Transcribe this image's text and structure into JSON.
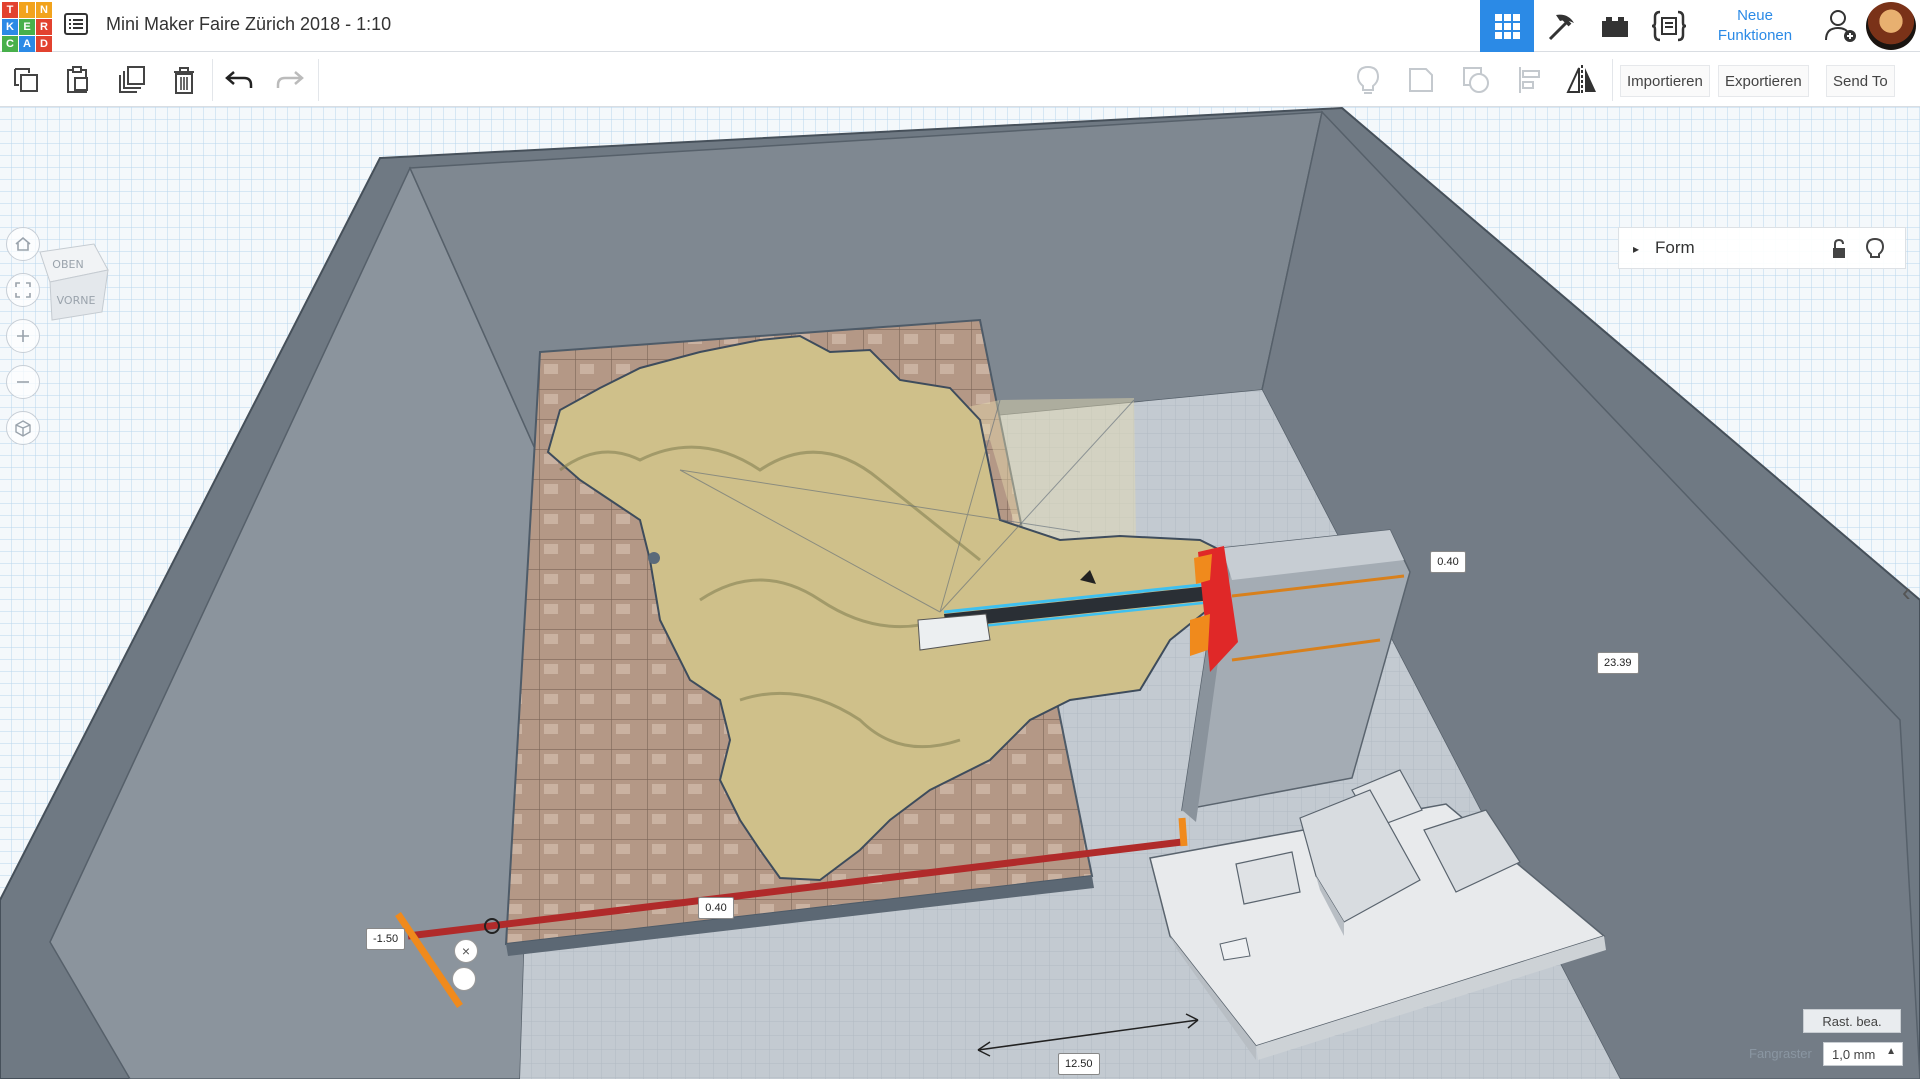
{
  "app": {
    "logo_letters": [
      "T",
      "I",
      "N",
      "K",
      "E",
      "R",
      "C",
      "A",
      "D"
    ],
    "logo_colors": [
      "#e2422f",
      "#f2a31c",
      "#f2a31c",
      "#2b8ae6",
      "#48b04b",
      "#e2422f",
      "#48b04b",
      "#2b8ae6",
      "#e2422f"
    ],
    "project_title": "Mini Maker Faire Zürich 2018 - 1:10",
    "accent_color": "#2b8ae6",
    "menu_icon": "list-menu-icon"
  },
  "topbar": {
    "views": [
      {
        "name": "3d-view",
        "icon": "grid-icon",
        "active": true
      },
      {
        "name": "blocks",
        "icon": "pickaxe-icon",
        "active": false
      },
      {
        "name": "bricks",
        "icon": "brick-icon",
        "active": false
      },
      {
        "name": "codeblocks",
        "icon": "code-icon",
        "active": false
      }
    ],
    "new_features_line1": "Neue",
    "new_features_line2": "Funktionen",
    "user_icon": "add-user-icon"
  },
  "toolbar": {
    "left_icons": [
      "copy-icon",
      "paste-icon",
      "duplicate-icon",
      "delete-icon",
      "undo-icon",
      "redo-icon"
    ],
    "right_icons": [
      "lightbulb-icon",
      "group-icon",
      "ungroup-icon",
      "align-icon",
      "mirror-icon"
    ],
    "import_label": "Importieren",
    "export_label": "Exportieren",
    "send_to_label": "Send To"
  },
  "viewcube": {
    "top_label": "OBEN",
    "front_label": "VORNE"
  },
  "nav": [
    "home-icon",
    "fit-view-icon",
    "zoom-in-icon",
    "zoom-out-icon",
    "ortho-view-icon"
  ],
  "shape_panel": {
    "title": "Form",
    "lock_icon": "lock-icon",
    "bulb_icon": "lightbulb-icon"
  },
  "dimensions": {
    "top_right": "0.40",
    "height": "23.39",
    "front": "0.40",
    "left": "-1.50",
    "bottom": "12.50"
  },
  "bottom": {
    "edit_grid_label": "Rast. bea.",
    "snap_label": "Fangraster",
    "snap_value": "1,0 mm"
  }
}
